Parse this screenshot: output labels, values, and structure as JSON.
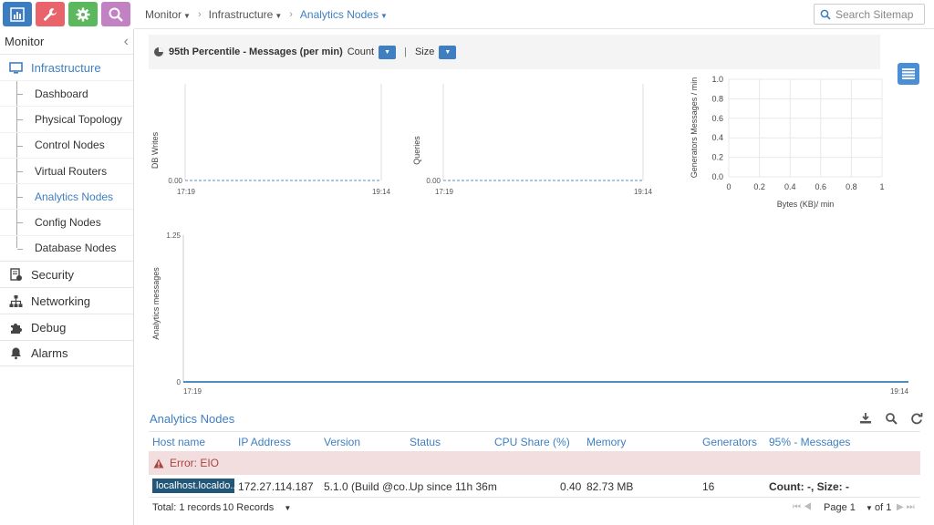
{
  "app": {
    "tabs": [
      {
        "name": "monitor",
        "color": "#3b7dc0",
        "icon": "bar-chart-icon"
      },
      {
        "name": "configure",
        "color": "#e8636a",
        "icon": "wrench-icon"
      },
      {
        "name": "settings",
        "color": "#5cb85c",
        "icon": "gear-icon"
      },
      {
        "name": "query",
        "color": "#c281c2",
        "icon": "search-icon"
      }
    ]
  },
  "breadcrumb": {
    "items": [
      "Monitor",
      "Infrastructure",
      "Analytics Nodes"
    ]
  },
  "search": {
    "placeholder": "Search Sitemap"
  },
  "sidebar": {
    "title": "Monitor",
    "infrastructure": "Infrastructure",
    "items": [
      "Dashboard",
      "Physical Topology",
      "Control Nodes",
      "Virtual Routers",
      "Analytics Nodes",
      "Config Nodes",
      "Database Nodes"
    ],
    "active_item": "Analytics Nodes",
    "sections": [
      "Security",
      "Networking",
      "Debug",
      "Alarms"
    ]
  },
  "filter": {
    "title": "95th Percentile - Messages (per min)",
    "count_label": "Count",
    "separator": "|",
    "size_label": "Size"
  },
  "chart_data": [
    {
      "type": "line",
      "ylabel": "DB Writes",
      "x": [
        "17:19",
        "19:14"
      ],
      "y_ticks": [
        "0.00"
      ],
      "values": [
        0,
        0
      ]
    },
    {
      "type": "line",
      "ylabel": "Queries",
      "x": [
        "17:19",
        "19:14"
      ],
      "y_ticks": [
        "0.00"
      ],
      "values": [
        0,
        0
      ]
    },
    {
      "type": "scatter",
      "xlabel": "Bytes (KB)/ min",
      "ylabel": "Generators Messages / min",
      "xlim": [
        0,
        1
      ],
      "ylim": [
        0,
        1
      ],
      "x_ticks": [
        "0",
        "0.2",
        "0.4",
        "0.6",
        "0.8",
        "1"
      ],
      "y_ticks": [
        "0.0",
        "0.2",
        "0.4",
        "0.6",
        "0.8",
        "1.0"
      ],
      "points": []
    },
    {
      "type": "line",
      "ylabel": "Analytics messages",
      "x": [
        "17:19",
        "19:14"
      ],
      "y_ticks": [
        "0",
        "1.25"
      ],
      "ylim": [
        0,
        1.25
      ],
      "values": [
        0,
        0
      ]
    }
  ],
  "grid": {
    "title": "Analytics Nodes",
    "columns": [
      "Host name",
      "IP Address",
      "Version",
      "Status",
      "CPU Share (%)",
      "Memory",
      "Generators",
      "95% - Messages"
    ],
    "error": "Error: EIO",
    "rows": [
      {
        "host": "localhost.localdo...",
        "ip": "172.27.114.187",
        "version": "5.1.0 (Build @co...",
        "status": "Up since 11h 36m",
        "cpu": "0.40",
        "memory": "82.73 MB",
        "generators": "16",
        "messages": "Count: -, Size: -"
      }
    ],
    "footer": {
      "total": "Total: 1 records",
      "page_size": "10 Records",
      "page": "Page 1",
      "of": "of 1"
    }
  },
  "colors": {
    "accent": "#3f7fc1",
    "error_bg": "#f2dede",
    "error_text": "#a94442",
    "host_badge": "#22577a"
  }
}
